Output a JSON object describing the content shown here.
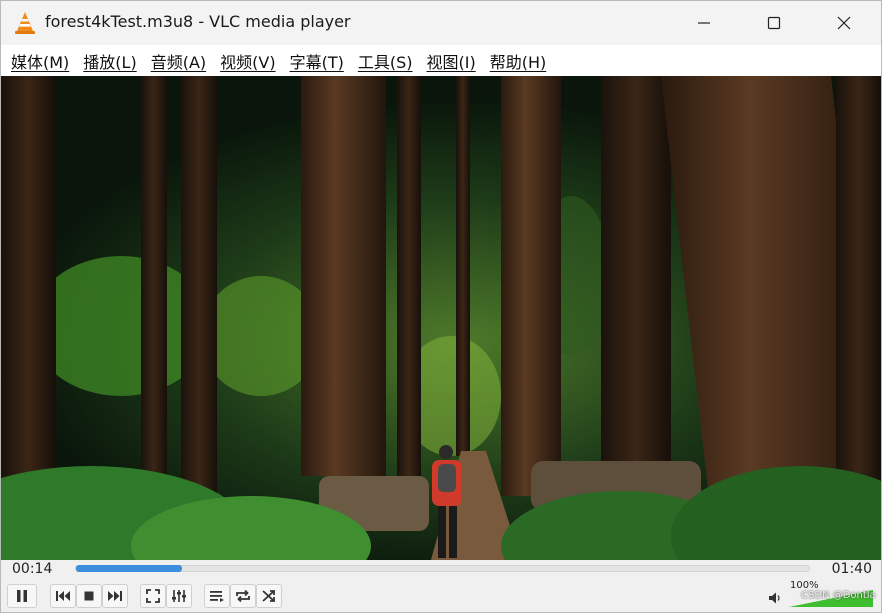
{
  "window": {
    "title": "forest4kTest.m3u8 - VLC media player",
    "app_icon": "vlc-cone-icon"
  },
  "title_buttons": [
    "minimize-icon",
    "maximize-icon",
    "close-icon"
  ],
  "menu": {
    "items": [
      {
        "label": "媒体(M)"
      },
      {
        "label": "播放(L)"
      },
      {
        "label": "音频(A)"
      },
      {
        "label": "视频(V)"
      },
      {
        "label": "字幕(T)"
      },
      {
        "label": "工具(S)"
      },
      {
        "label": "视图(I)"
      },
      {
        "label": "帮助(H)"
      }
    ]
  },
  "playback": {
    "elapsed": "00:14",
    "total": "01:40",
    "progress_fraction": 0.145
  },
  "controls": {
    "buttons": [
      "pause-icon",
      "previous-icon",
      "stop-icon",
      "next-icon",
      "fullscreen-icon",
      "extended-settings-icon",
      "playlist-icon",
      "loop-icon",
      "shuffle-icon"
    ]
  },
  "volume": {
    "label": "100%",
    "level_fraction": 1.0
  },
  "watermark": "CSDN @Dontla",
  "colors": {
    "seek_fill": "#3c8fdc",
    "volume_fill": "#3fbf2f",
    "title_bg": "#f3f3f3"
  }
}
